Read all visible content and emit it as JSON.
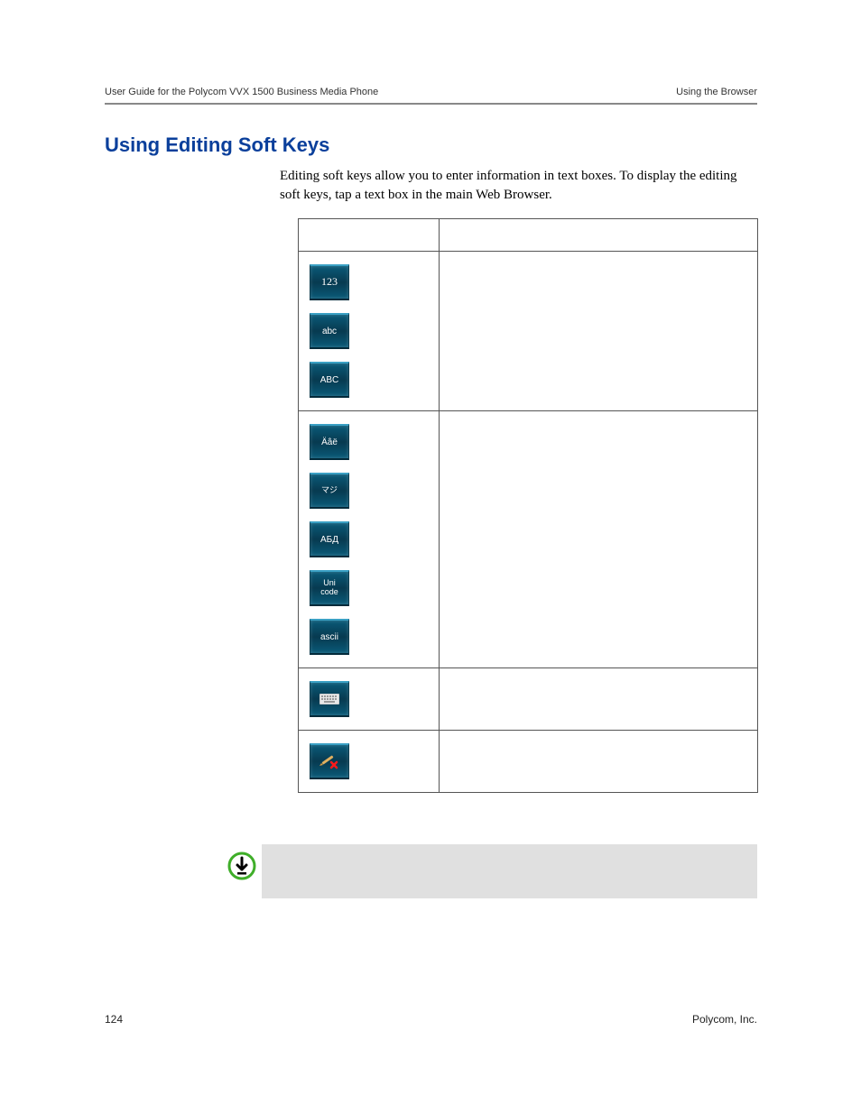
{
  "header": {
    "left": "User Guide for the Polycom VVX 1500 Business Media Phone",
    "right": "Using the Browser"
  },
  "heading": "Using Editing Soft Keys",
  "intro": "Editing soft keys allow you to enter information in text boxes. To display the editing soft keys, tap a text box in the main Web Browser.",
  "keys": {
    "k123": "123",
    "kabc": "abc",
    "kABC": "ABC",
    "kLatin": "Äâë",
    "kKana": "マジ",
    "kCyr": "АБД",
    "kUni1": "Uni",
    "kUni2": "code",
    "kAscii": "ascii"
  },
  "footer": {
    "page": "124",
    "company": "Polycom, Inc."
  }
}
